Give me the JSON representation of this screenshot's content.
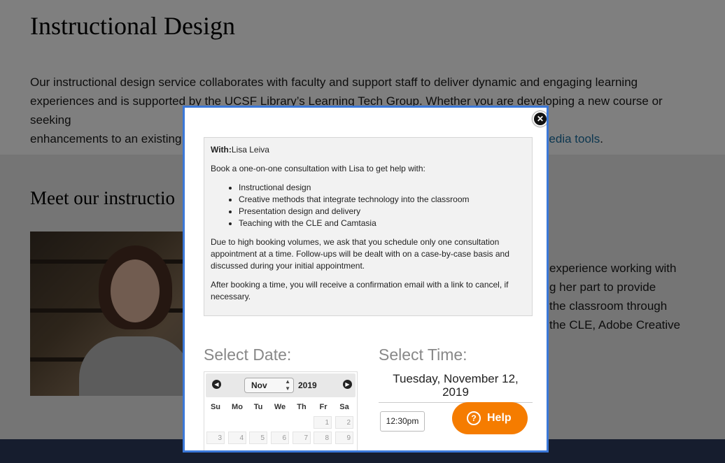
{
  "page": {
    "title": "Instructional Design",
    "intro_line1": "Our instructional design service collaborates with faculty and support staff to deliver dynamic and engaging learning",
    "intro_line2": "experiences and is supported by the UCSF Library’s Learning Tech Group. Whether you are developing a new course or seeking",
    "intro_line3_start": "enhancements to an existing",
    "intro_link": "edia tools",
    "intro_end": ".",
    "section_heading": "Meet our instructio",
    "bio_lines": [
      "experience working with",
      "g her part to provide",
      "the classroom through",
      "the CLE, Adobe Creative"
    ]
  },
  "modal": {
    "close_symbol": "✕",
    "with_label": "With:",
    "with_name": "Lisa Leiva",
    "book_text": "Book a one-on-one consultation with Lisa to get help with:",
    "topics": [
      "Instructional design",
      "Creative methods that integrate technology into the classroom",
      "Presentation design and delivery",
      "Teaching with the CLE and Camtasia"
    ],
    "policy_text": "Due to high booking volumes, we ask that you schedule only one consultation appointment at a time. Follow-ups will be dealt with on a case-by-case basis and discussed during your initial appointment.",
    "confirm_text": "After booking a time, you will receive a confirmation email with a link to cancel, if necessary.",
    "select_date_label": "Select Date:",
    "select_time_label": "Select Time:",
    "calendar": {
      "month": "Nov",
      "year": "2019",
      "weekdays": [
        "Su",
        "Mo",
        "Tu",
        "We",
        "Th",
        "Fr",
        "Sa"
      ],
      "days": [
        "1",
        "2",
        "3",
        "4",
        "5",
        "6",
        "7",
        "8",
        "9"
      ]
    },
    "selected_date": "Tuesday, November 12, 2019",
    "time_slots": [
      "12:30pm"
    ]
  },
  "help_button": {
    "label": "Help",
    "icon": "?"
  },
  "colors": {
    "accent": "#3b78d8",
    "help": "#f57c00",
    "link": "#1a6fa0",
    "footer": "#2c3a5c"
  }
}
